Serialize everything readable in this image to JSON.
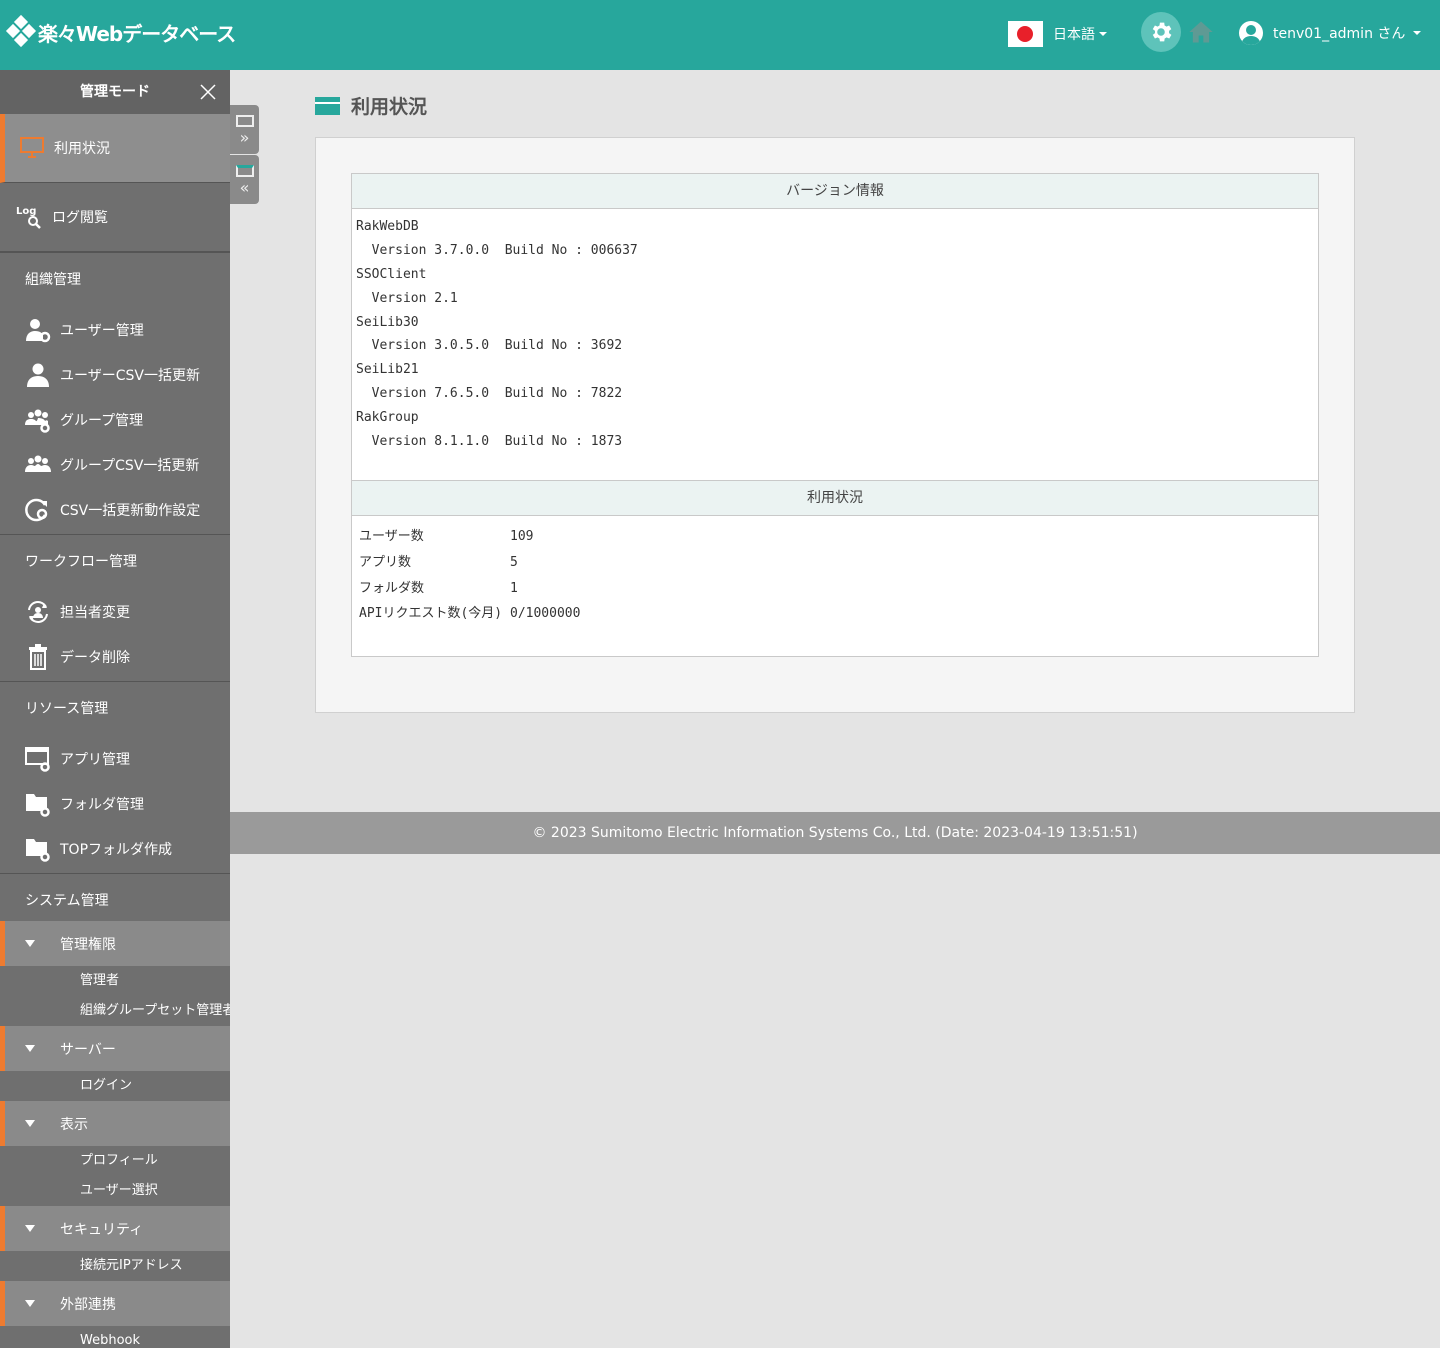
{
  "header": {
    "logo_text": "楽々Webデータベース",
    "language": "日本語",
    "user": "tenv01_admin さん"
  },
  "sidebar": {
    "title": "管理モード",
    "main_items": [
      {
        "label": "利用状況",
        "icon": "monitor-icon"
      },
      {
        "label": "ログ閲覧",
        "icon": "log-search-icon"
      }
    ],
    "sections": {
      "org": {
        "title": "組織管理",
        "items": [
          "ユーザー管理",
          "ユーザーCSV一括更新",
          "グループ管理",
          "グループCSV一括更新",
          "CSV一括更新動作設定"
        ]
      },
      "workflow": {
        "title": "ワークフロー管理",
        "items": [
          "担当者変更",
          "データ削除"
        ]
      },
      "resource": {
        "title": "リソース管理",
        "items": [
          "アプリ管理",
          "フォルダ管理",
          "TOPフォルダ作成"
        ]
      },
      "system": {
        "title": "システム管理",
        "groups": [
          {
            "label": "管理権限",
            "subs": [
              "管理者",
              "組織グループセット管理者"
            ]
          },
          {
            "label": "サーバー",
            "subs": [
              "ログイン"
            ]
          },
          {
            "label": "表示",
            "subs": [
              "プロフィール",
              "ユーザー選択"
            ]
          },
          {
            "label": "セキュリティ",
            "subs": [
              "接続元IPアドレス"
            ]
          },
          {
            "label": "外部連携",
            "subs": [
              "Webhook"
            ]
          }
        ]
      }
    }
  },
  "main": {
    "title": "利用状況",
    "version_header": "バージョン情報",
    "version_lines": [
      "RakWebDB",
      "  Version 3.7.0.0  Build No : 006637",
      "SSOClient",
      "  Version 2.1",
      "SeiLib30",
      "  Version 3.0.5.0  Build No : 3692",
      "SeiLib21",
      "  Version 7.6.5.0  Build No : 7822",
      "RakGroup",
      "  Version 8.1.1.0  Build No : 1873"
    ],
    "usage_header": "利用状況",
    "usage_rows": [
      {
        "k": "ユーザー数",
        "v": "109"
      },
      {
        "k": "アプリ数",
        "v": "5"
      },
      {
        "k": "フォルダ数",
        "v": "1"
      },
      {
        "k": "APIリクエスト数(今月)",
        "v": "0/1000000"
      }
    ]
  },
  "footer": "© 2023 Sumitomo Electric Information Systems Co., Ltd. (Date: 2023-04-19 13:51:51)",
  "colors": {
    "brand": "#27a79c",
    "accent": "#ee7b30",
    "sidebar": "#6f6f6f"
  }
}
